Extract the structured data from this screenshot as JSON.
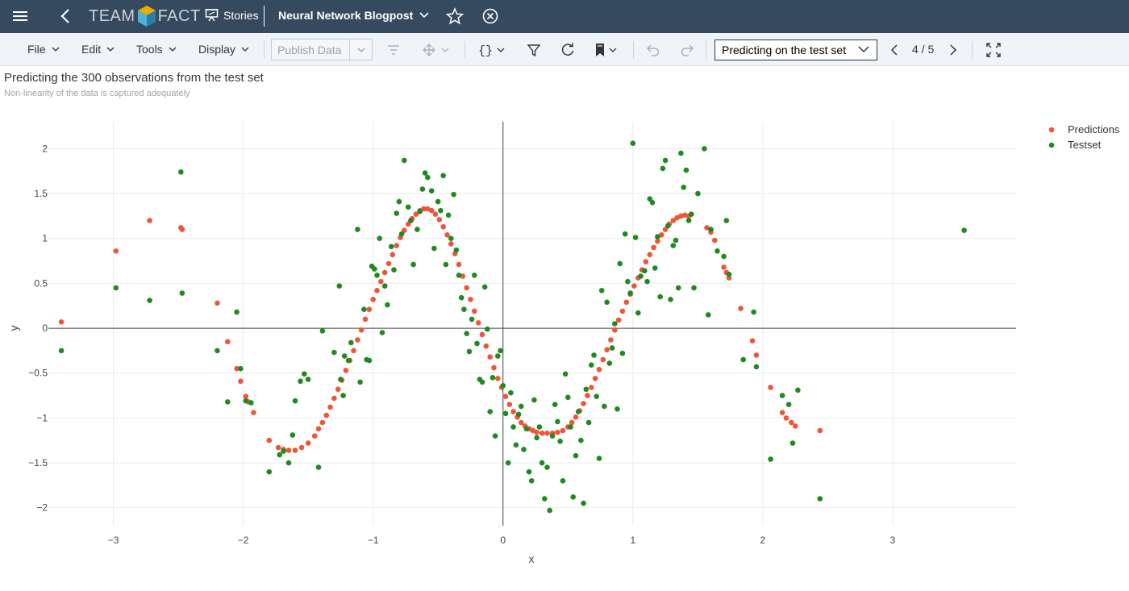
{
  "shell": {
    "logo_left": "TEAM",
    "logo_right": "FACT",
    "stories_label": "Stories",
    "document_title": "Neural Network Blogpost"
  },
  "toolbar": {
    "file": "File",
    "edit": "Edit",
    "tools": "Tools",
    "display": "Display",
    "publish_data": "Publish Data",
    "page_select": "Predicting on the test set",
    "page_indicator": "4 / 5"
  },
  "story": {
    "title": "Predicting the 300 observations from the test set",
    "subtitle": "Non-linearity of the data is captured adequately"
  },
  "colors": {
    "shell": "#354a5f",
    "predictions": "#ef553b",
    "testset": "#1f8a1f"
  },
  "chart_data": {
    "type": "scatter",
    "xlabel": "x",
    "ylabel": "y",
    "xlim": [
      -3.5,
      3.95
    ],
    "ylim": [
      -2.2,
      2.3
    ],
    "xticks": [
      -3,
      -2,
      -1,
      0,
      1,
      2,
      3
    ],
    "xtick_labels": [
      "−3",
      "−2",
      "−1",
      "0",
      "1",
      "2",
      "3"
    ],
    "yticks": [
      -2,
      -1.5,
      -1,
      -0.5,
      0,
      0.5,
      1,
      1.5,
      2
    ],
    "ytick_labels": [
      "−2",
      "−1.5",
      "−1",
      "−0.5",
      "0",
      "0.5",
      "1",
      "1.5",
      "2"
    ],
    "grid": true,
    "legend": "top-right",
    "series": [
      {
        "name": "Predictions",
        "color": "#ef553b",
        "points": [
          [
            -3.4,
            0.07
          ],
          [
            -2.98,
            0.86
          ],
          [
            -2.72,
            1.2
          ],
          [
            -2.48,
            1.12
          ],
          [
            -2.47,
            1.1
          ],
          [
            -2.2,
            0.28
          ],
          [
            -2.12,
            -0.15
          ],
          [
            -2.05,
            -0.45
          ],
          [
            -2.02,
            -0.59
          ],
          [
            -1.98,
            -0.76
          ],
          [
            -1.96,
            -0.82
          ],
          [
            -1.92,
            -0.94
          ],
          [
            -1.8,
            -1.25
          ],
          [
            -1.73,
            -1.33
          ],
          [
            -1.69,
            -1.35
          ],
          [
            -1.65,
            -1.36
          ],
          [
            -1.6,
            -1.36
          ],
          [
            -1.55,
            -1.33
          ],
          [
            -1.5,
            -1.28
          ],
          [
            -1.45,
            -1.2
          ],
          [
            -1.42,
            -1.12
          ],
          [
            -1.39,
            -1.05
          ],
          [
            -1.36,
            -0.97
          ],
          [
            -1.33,
            -0.88
          ],
          [
            -1.3,
            -0.78
          ],
          [
            -1.27,
            -0.68
          ],
          [
            -1.24,
            -0.58
          ],
          [
            -1.21,
            -0.47
          ],
          [
            -1.18,
            -0.36
          ],
          [
            -1.15,
            -0.25
          ],
          [
            -1.12,
            -0.13
          ],
          [
            -1.09,
            -0.02
          ],
          [
            -1.06,
            0.1
          ],
          [
            -1.03,
            0.21
          ],
          [
            -1.0,
            0.32
          ],
          [
            -0.97,
            0.42
          ],
          [
            -0.94,
            0.52
          ],
          [
            -0.91,
            0.62
          ],
          [
            -0.88,
            0.72
          ],
          [
            -0.85,
            0.82
          ],
          [
            -0.82,
            0.92
          ],
          [
            -0.79,
            1.01
          ],
          [
            -0.76,
            1.09
          ],
          [
            -0.73,
            1.16
          ],
          [
            -0.7,
            1.22
          ],
          [
            -0.67,
            1.27
          ],
          [
            -0.64,
            1.31
          ],
          [
            -0.61,
            1.33
          ],
          [
            -0.58,
            1.33
          ],
          [
            -0.55,
            1.31
          ],
          [
            -0.52,
            1.27
          ],
          [
            -0.49,
            1.21
          ],
          [
            -0.46,
            1.13
          ],
          [
            -0.43,
            1.04
          ],
          [
            -0.4,
            0.94
          ],
          [
            -0.37,
            0.83
          ],
          [
            -0.34,
            0.71
          ],
          [
            -0.31,
            0.58
          ],
          [
            -0.28,
            0.45
          ],
          [
            -0.25,
            0.32
          ],
          [
            -0.22,
            0.19
          ],
          [
            -0.19,
            0.06
          ],
          [
            -0.16,
            -0.07
          ],
          [
            -0.13,
            -0.2
          ],
          [
            -0.1,
            -0.32
          ],
          [
            -0.07,
            -0.44
          ],
          [
            -0.04,
            -0.56
          ],
          [
            -0.01,
            -0.66
          ],
          [
            0.02,
            -0.76
          ],
          [
            0.05,
            -0.85
          ],
          [
            0.08,
            -0.93
          ],
          [
            0.11,
            -0.99
          ],
          [
            0.14,
            -1.05
          ],
          [
            0.17,
            -1.09
          ],
          [
            0.2,
            -1.12
          ],
          [
            0.23,
            -1.14
          ],
          [
            0.26,
            -1.16
          ],
          [
            0.3,
            -1.17
          ],
          [
            0.34,
            -1.17
          ],
          [
            0.38,
            -1.17
          ],
          [
            0.42,
            -1.16
          ],
          [
            0.46,
            -1.14
          ],
          [
            0.5,
            -1.1
          ],
          [
            0.53,
            -1.05
          ],
          [
            0.56,
            -0.99
          ],
          [
            0.59,
            -0.92
          ],
          [
            0.62,
            -0.84
          ],
          [
            0.65,
            -0.75
          ],
          [
            0.68,
            -0.66
          ],
          [
            0.71,
            -0.56
          ],
          [
            0.74,
            -0.46
          ],
          [
            0.77,
            -0.35
          ],
          [
            0.8,
            -0.24
          ],
          [
            0.83,
            -0.13
          ],
          [
            0.86,
            -0.02
          ],
          [
            0.89,
            0.09
          ],
          [
            0.92,
            0.19
          ],
          [
            0.95,
            0.29
          ],
          [
            0.98,
            0.38
          ],
          [
            1.01,
            0.47
          ],
          [
            1.04,
            0.56
          ],
          [
            1.07,
            0.65
          ],
          [
            1.1,
            0.74
          ],
          [
            1.13,
            0.82
          ],
          [
            1.16,
            0.9
          ],
          [
            1.19,
            0.97
          ],
          [
            1.22,
            1.04
          ],
          [
            1.25,
            1.1
          ],
          [
            1.28,
            1.16
          ],
          [
            1.31,
            1.2
          ],
          [
            1.34,
            1.23
          ],
          [
            1.37,
            1.25
          ],
          [
            1.4,
            1.26
          ],
          [
            1.43,
            1.25
          ],
          [
            1.57,
            1.12
          ],
          [
            1.6,
            1.07
          ],
          [
            1.63,
            0.98
          ],
          [
            1.7,
            0.68
          ],
          [
            1.72,
            0.62
          ],
          [
            1.74,
            0.56
          ],
          [
            1.83,
            0.22
          ],
          [
            1.92,
            -0.14
          ],
          [
            1.95,
            -0.3
          ],
          [
            2.06,
            -0.66
          ],
          [
            2.15,
            -0.94
          ],
          [
            2.18,
            -1.0
          ],
          [
            2.22,
            -1.05
          ],
          [
            2.25,
            -1.09
          ],
          [
            2.44,
            -1.14
          ]
        ]
      },
      {
        "name": "Testset",
        "color": "#1f8a1f",
        "points": [
          [
            -3.4,
            -0.25
          ],
          [
            -2.98,
            0.45
          ],
          [
            -2.72,
            0.31
          ],
          [
            -2.48,
            1.74
          ],
          [
            -2.47,
            0.39
          ],
          [
            -2.2,
            -0.25
          ],
          [
            -2.12,
            -0.82
          ],
          [
            -2.05,
            0.18
          ],
          [
            -2.02,
            -0.45
          ],
          [
            -1.98,
            -0.81
          ],
          [
            -1.94,
            -0.83
          ],
          [
            -1.8,
            -1.6
          ],
          [
            -1.72,
            -1.41
          ],
          [
            -1.69,
            -1.37
          ],
          [
            -1.65,
            -1.5
          ],
          [
            -1.62,
            -1.19
          ],
          [
            -1.6,
            -0.81
          ],
          [
            -1.56,
            -0.59
          ],
          [
            -1.53,
            -0.51
          ],
          [
            -1.5,
            -0.57
          ],
          [
            -1.42,
            -1.55
          ],
          [
            -1.39,
            -0.03
          ],
          [
            -1.3,
            -0.27
          ],
          [
            -1.26,
            0.47
          ],
          [
            -1.25,
            -0.57
          ],
          [
            -1.23,
            -0.75
          ],
          [
            -1.22,
            -0.31
          ],
          [
            -1.19,
            -0.36
          ],
          [
            -1.17,
            -0.16
          ],
          [
            -1.12,
            1.1
          ],
          [
            -1.1,
            -0.6
          ],
          [
            -1.07,
            0.21
          ],
          [
            -1.05,
            -0.35
          ],
          [
            -1.03,
            -0.36
          ],
          [
            -1.01,
            0.69
          ],
          [
            -0.99,
            0.66
          ],
          [
            -0.97,
            0.59
          ],
          [
            -0.95,
            1.0
          ],
          [
            -0.93,
            -0.05
          ],
          [
            -0.91,
            0.47
          ],
          [
            -0.89,
            0.26
          ],
          [
            -0.86,
            0.91
          ],
          [
            -0.84,
            0.65
          ],
          [
            -0.82,
            1.28
          ],
          [
            -0.8,
            1.41
          ],
          [
            -0.78,
            1.05
          ],
          [
            -0.76,
            1.87
          ],
          [
            -0.73,
            1.35
          ],
          [
            -0.71,
            1.2
          ],
          [
            -0.69,
            0.71
          ],
          [
            -0.66,
            1.1
          ],
          [
            -0.64,
            1.3
          ],
          [
            -0.62,
            1.55
          ],
          [
            -0.6,
            1.73
          ],
          [
            -0.58,
            1.68
          ],
          [
            -0.55,
            1.53
          ],
          [
            -0.53,
            0.89
          ],
          [
            -0.5,
            1.41
          ],
          [
            -0.48,
            1.31
          ],
          [
            -0.46,
            1.7
          ],
          [
            -0.44,
            0.71
          ],
          [
            -0.42,
            1.26
          ],
          [
            -0.4,
            1.0
          ],
          [
            -0.38,
            1.49
          ],
          [
            -0.36,
            0.87
          ],
          [
            -0.34,
            0.59
          ],
          [
            -0.32,
            0.34
          ],
          [
            -0.3,
            0.21
          ],
          [
            -0.28,
            -0.06
          ],
          [
            -0.26,
            -0.26
          ],
          [
            -0.24,
            0.1
          ],
          [
            -0.22,
            0.59
          ],
          [
            -0.2,
            -0.17
          ],
          [
            -0.18,
            -0.57
          ],
          [
            -0.16,
            -0.6
          ],
          [
            -0.14,
            0.46
          ],
          [
            -0.12,
            -0.01
          ],
          [
            -0.1,
            -0.93
          ],
          [
            -0.08,
            -0.55
          ],
          [
            -0.06,
            -1.2
          ],
          [
            -0.04,
            -0.31
          ],
          [
            -0.02,
            -0.25
          ],
          [
            0.0,
            -0.64
          ],
          [
            0.02,
            -0.95
          ],
          [
            0.04,
            -1.5
          ],
          [
            0.06,
            -0.72
          ],
          [
            0.08,
            -1.1
          ],
          [
            0.1,
            -1.3
          ],
          [
            0.12,
            -0.96
          ],
          [
            0.14,
            -0.87
          ],
          [
            0.16,
            -1.35
          ],
          [
            0.18,
            -1.12
          ],
          [
            0.2,
            -1.6
          ],
          [
            0.22,
            -1.7
          ],
          [
            0.24,
            -0.8
          ],
          [
            0.26,
            -1.22
          ],
          [
            0.28,
            -1.1
          ],
          [
            0.3,
            -1.5
          ],
          [
            0.32,
            -1.9
          ],
          [
            0.34,
            -1.55
          ],
          [
            0.36,
            -2.03
          ],
          [
            0.38,
            -1.2
          ],
          [
            0.4,
            -0.85
          ],
          [
            0.42,
            -1.04
          ],
          [
            0.44,
            -1.26
          ],
          [
            0.46,
            -1.7
          ],
          [
            0.48,
            -0.51
          ],
          [
            0.5,
            -0.77
          ],
          [
            0.52,
            -1.1
          ],
          [
            0.54,
            -1.88
          ],
          [
            0.56,
            -1.42
          ],
          [
            0.58,
            -0.93
          ],
          [
            0.6,
            -1.25
          ],
          [
            0.62,
            -1.95
          ],
          [
            0.64,
            -0.68
          ],
          [
            0.66,
            -1.05
          ],
          [
            0.68,
            -0.41
          ],
          [
            0.7,
            -0.3
          ],
          [
            0.72,
            -0.76
          ],
          [
            0.74,
            -1.45
          ],
          [
            0.76,
            0.42
          ],
          [
            0.78,
            -0.87
          ],
          [
            0.8,
            0.29
          ],
          [
            0.82,
            -0.39
          ],
          [
            0.84,
            -0.22
          ],
          [
            0.86,
            0.05
          ],
          [
            0.88,
            -0.9
          ],
          [
            0.9,
            0.72
          ],
          [
            0.92,
            -0.28
          ],
          [
            0.94,
            1.05
          ],
          [
            0.96,
            0.52
          ],
          [
            0.98,
            0.39
          ],
          [
            1.0,
            2.06
          ],
          [
            1.02,
            1.01
          ],
          [
            1.04,
            0.17
          ],
          [
            1.06,
            0.58
          ],
          [
            1.09,
            0.64
          ],
          [
            1.11,
            0.52
          ],
          [
            1.13,
            1.44
          ],
          [
            1.15,
            1.4
          ],
          [
            1.17,
            0.67
          ],
          [
            1.19,
            1.02
          ],
          [
            1.21,
            0.35
          ],
          [
            1.23,
            1.78
          ],
          [
            1.25,
            1.87
          ],
          [
            1.27,
            1.14
          ],
          [
            1.29,
            0.32
          ],
          [
            1.31,
            0.92
          ],
          [
            1.33,
            0.98
          ],
          [
            1.35,
            0.45
          ],
          [
            1.37,
            1.95
          ],
          [
            1.39,
            1.57
          ],
          [
            1.41,
            1.76
          ],
          [
            1.43,
            1.2
          ],
          [
            1.45,
            1.27
          ],
          [
            1.47,
            0.45
          ],
          [
            1.5,
            1.5
          ],
          [
            1.55,
            2.0
          ],
          [
            1.58,
            0.15
          ],
          [
            1.6,
            1.1
          ],
          [
            1.65,
            0.86
          ],
          [
            1.7,
            0.8
          ],
          [
            1.72,
            1.2
          ],
          [
            1.74,
            0.6
          ],
          [
            1.85,
            -0.35
          ],
          [
            1.93,
            0.18
          ],
          [
            1.95,
            -0.43
          ],
          [
            2.06,
            -1.46
          ],
          [
            2.15,
            -0.75
          ],
          [
            2.2,
            -0.85
          ],
          [
            2.23,
            -1.28
          ],
          [
            2.27,
            -0.69
          ],
          [
            2.44,
            -1.9
          ],
          [
            3.55,
            1.09
          ]
        ]
      }
    ]
  }
}
